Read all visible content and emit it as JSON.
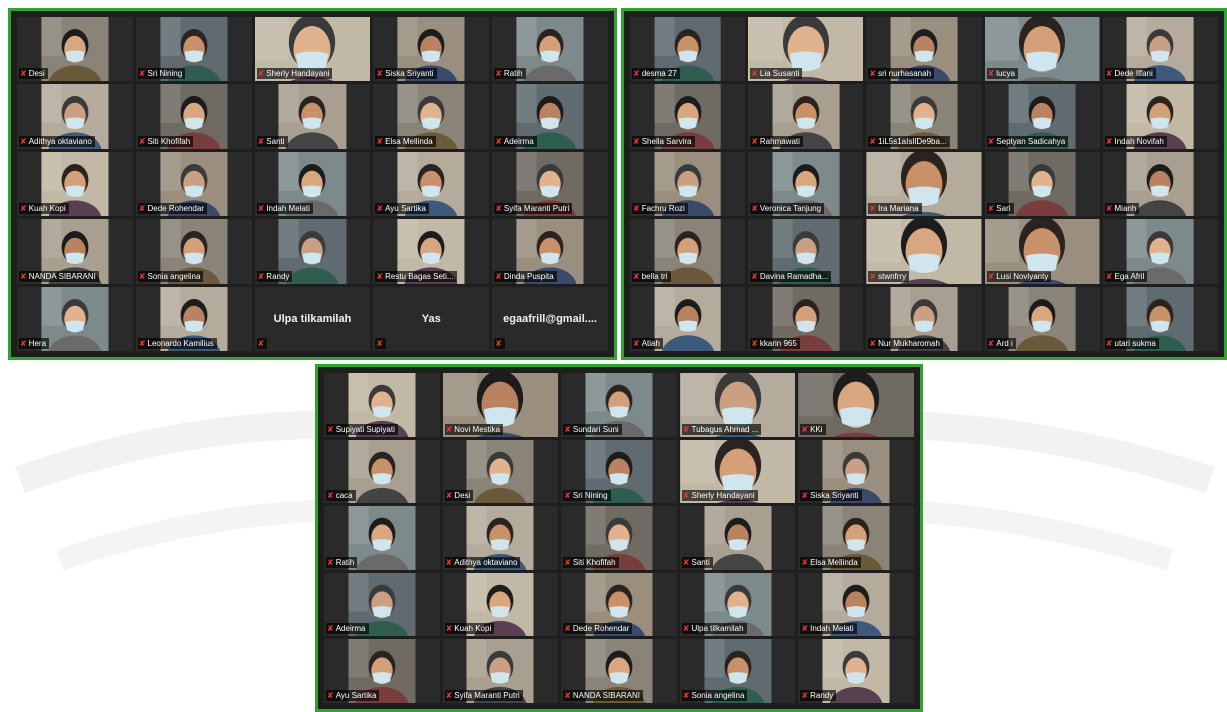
{
  "colors": {
    "panel_border": "#2fa52f",
    "panel_bg": "#1e1e1e",
    "tile_bg": "#2a2a2a",
    "mic_muted": "#e53935",
    "active_speaker": "#e6e64a"
  },
  "icons": {
    "mic": "mic-muted-icon"
  },
  "panels": [
    {
      "tiles": [
        {
          "name": "Desi",
          "video": true
        },
        {
          "name": "Sri Nining",
          "video": true
        },
        {
          "name": "Sherly Handayani",
          "video": true,
          "wide": true
        },
        {
          "name": "Siska Sriyanti",
          "video": true
        },
        {
          "name": "Ratih",
          "video": true
        },
        {
          "name": "Adithya oktaviano",
          "video": true
        },
        {
          "name": "Siti Khofifah",
          "video": true
        },
        {
          "name": "Santi",
          "video": true
        },
        {
          "name": "Elsa Mellinda",
          "video": true
        },
        {
          "name": "Adeirma",
          "video": true
        },
        {
          "name": "Kuah Kopi",
          "video": true
        },
        {
          "name": "Dede Rohendar",
          "video": true
        },
        {
          "name": "Indah Melati",
          "video": true
        },
        {
          "name": "Ayu Sartika",
          "video": true
        },
        {
          "name": "Syifa Maranti Putri",
          "video": true
        },
        {
          "name": "NANDA SIBARANI",
          "video": true
        },
        {
          "name": "Sonia angelina",
          "video": true
        },
        {
          "name": "Randy",
          "video": true
        },
        {
          "name": "Restu Bagas Seti...",
          "video": true
        },
        {
          "name": "Dinda Puspita",
          "video": true
        },
        {
          "name": "Hera",
          "video": true
        },
        {
          "name": "Leonardo Kamilius",
          "video": true
        },
        {
          "name": "Ulpa tilkamilah",
          "video": false
        },
        {
          "name": "Yas",
          "video": false
        },
        {
          "name": "egaafrill@gmail....",
          "video": false
        }
      ]
    },
    {
      "tiles": [
        {
          "name": "desma 27",
          "video": true
        },
        {
          "name": "Lia Susanti",
          "video": true,
          "active": true,
          "wide": true
        },
        {
          "name": "sri nurhasanah",
          "video": true
        },
        {
          "name": "lucya",
          "video": true,
          "wide": true
        },
        {
          "name": "Dede Ilfani",
          "video": true
        },
        {
          "name": "Shella Sarvira",
          "video": true
        },
        {
          "name": "Rahmawati",
          "video": true
        },
        {
          "name": "1iL5s1aIsIlDe9ba...",
          "video": true
        },
        {
          "name": "Septyan Sadicahya",
          "video": true
        },
        {
          "name": "Indah Novifah",
          "video": true
        },
        {
          "name": "Fachru Rozi",
          "video": true
        },
        {
          "name": "Veronica Tanjung",
          "video": true
        },
        {
          "name": "Ira Mariana",
          "video": true,
          "wide": true
        },
        {
          "name": "Sari",
          "video": true
        },
        {
          "name": "Mianh",
          "video": true
        },
        {
          "name": "bella tri",
          "video": true
        },
        {
          "name": "Davina Ramadha...",
          "video": true
        },
        {
          "name": "stwnfrry",
          "video": true,
          "wide": true
        },
        {
          "name": "Lusi Noviyanty",
          "video": true,
          "wide": true
        },
        {
          "name": "Ega Afril",
          "video": true
        },
        {
          "name": "Atiah",
          "video": true
        },
        {
          "name": "kkarin 965",
          "video": true
        },
        {
          "name": "Nur Mukharomah",
          "video": true
        },
        {
          "name": "Ard i",
          "video": true
        },
        {
          "name": "utari sukma",
          "video": true
        }
      ]
    },
    {
      "tiles": [
        {
          "name": "Supiyati Supiyati",
          "video": true
        },
        {
          "name": "Novi Mestika",
          "video": true,
          "wide": true
        },
        {
          "name": "Sundari Suni",
          "video": true
        },
        {
          "name": "Tubagus Ahmad ...",
          "video": true,
          "wide": true
        },
        {
          "name": "KKi",
          "video": true,
          "wide": true
        },
        {
          "name": "caca",
          "video": true
        },
        {
          "name": "Desi",
          "video": true
        },
        {
          "name": "Sri Nining",
          "video": true
        },
        {
          "name": "Sherly Handayani",
          "video": true,
          "wide": true
        },
        {
          "name": "Siska Sriyanti",
          "video": true
        },
        {
          "name": "Ratih",
          "video": true
        },
        {
          "name": "Adithya oktaviano",
          "video": true
        },
        {
          "name": "Siti Khofifah",
          "video": true
        },
        {
          "name": "Santi",
          "video": true
        },
        {
          "name": "Elsa Mellinda",
          "video": true
        },
        {
          "name": "Adeirma",
          "video": true
        },
        {
          "name": "Kuah Kopi",
          "video": true
        },
        {
          "name": "Dede Rohendar",
          "video": true
        },
        {
          "name": "Ulpa tilkamilah",
          "video": true
        },
        {
          "name": "Indah Melati",
          "video": true
        },
        {
          "name": "Ayu Sartika",
          "video": true
        },
        {
          "name": "Syifa Maranti Putri",
          "video": true
        },
        {
          "name": "NANDA SIBARANI",
          "video": true
        },
        {
          "name": "Sonia angelina",
          "video": true
        },
        {
          "name": "Randy",
          "video": true
        }
      ]
    }
  ]
}
